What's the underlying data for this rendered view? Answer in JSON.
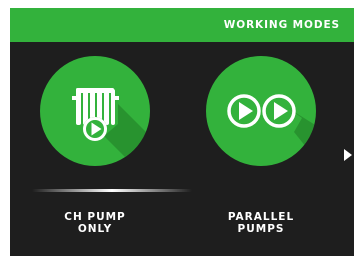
{
  "header": {
    "title": "WORKING MODES"
  },
  "modes": [
    {
      "label_line1": "CH PUMP",
      "label_line2": "ONLY",
      "icon": "radiator-play-icon",
      "selected": true
    },
    {
      "label_line1": "PARALLEL",
      "label_line2": "PUMPS",
      "icon": "double-play-icon",
      "selected": false
    }
  ],
  "navigation": {
    "next_icon": "chevron-right-icon"
  },
  "colors": {
    "accent": "#33b23c",
    "background": "#1e1e1e",
    "text": "#ffffff",
    "shadow": "#1f7a25"
  }
}
